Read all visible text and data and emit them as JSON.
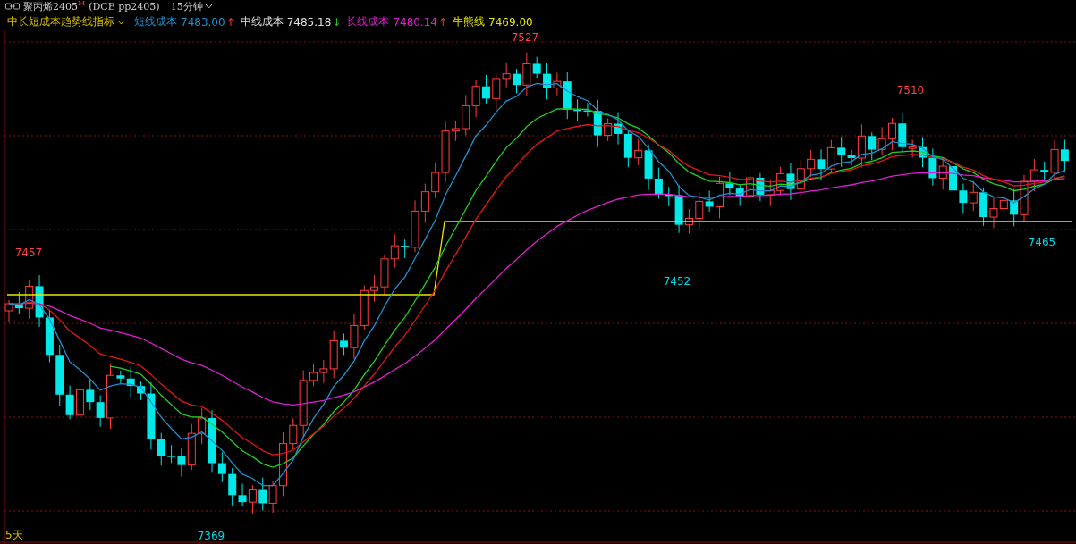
{
  "header": {
    "title": "聚丙烯2405",
    "title_mark": "M",
    "exchange": "(DCE pp2405)",
    "period": "15分钟"
  },
  "indicator": {
    "name": "中长短成本趋势线指标",
    "items": [
      {
        "label": "短线成本",
        "value": "7483.00",
        "arrow": "↑",
        "rising": true,
        "color": "#1e90d0"
      },
      {
        "label": "中线成本",
        "value": "7485.18",
        "arrow": "↓",
        "rising": false,
        "color": "#e0e0e0"
      },
      {
        "label": "长线成本",
        "value": "7480.14",
        "arrow": "↑",
        "rising": true,
        "color": "#e020d0"
      },
      {
        "label": "牛熊线",
        "value": "7469.00",
        "color": "#e8e800"
      }
    ]
  },
  "price_labels": [
    {
      "text": "7457",
      "kind": "high"
    },
    {
      "text": "7527",
      "kind": "high"
    },
    {
      "text": "7510",
      "kind": "high"
    },
    {
      "text": "7452",
      "kind": "low"
    },
    {
      "text": "7465",
      "kind": "low"
    },
    {
      "text": "7369",
      "kind": "low"
    }
  ],
  "range_label": "5天"
}
